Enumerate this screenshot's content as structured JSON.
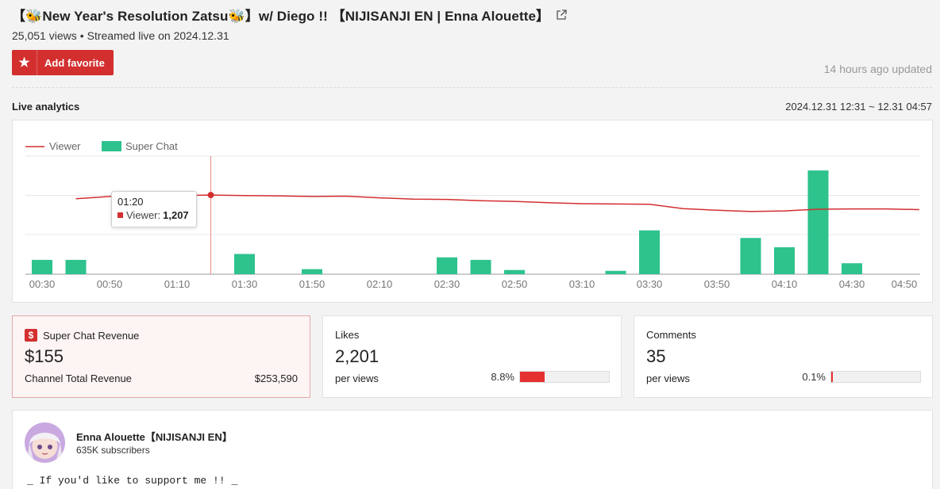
{
  "video": {
    "title": "【🐝New Year's Resolution Zatsu🐝】w/ Diego !! 【NIJISANJI EN | Enna Alouette】",
    "views": "25,051 views",
    "streamed": "Streamed live on 2024.12.31",
    "favorite_label": "Add favorite",
    "updated": "14 hours ago updated"
  },
  "analytics": {
    "section_title": "Live analytics",
    "range": "2024.12.31 12:31 ~ 12.31 04:57",
    "tooltip": {
      "time": "01:20",
      "label": "Viewer:",
      "value": "1,207"
    }
  },
  "chart_data": {
    "type": "line+bar",
    "legend": [
      "Viewer",
      "Super Chat"
    ],
    "legend_position": "top-left",
    "x_ticks": [
      "00:30",
      "00:50",
      "01:10",
      "01:30",
      "01:50",
      "02:10",
      "02:30",
      "02:50",
      "03:10",
      "03:30",
      "03:50",
      "04:10",
      "04:30",
      "04:50"
    ],
    "viewer": {
      "name": "Viewer",
      "color": "#d32f2f",
      "x_minutes": [
        40,
        50,
        60,
        70,
        80,
        90,
        100,
        110,
        120,
        130,
        140,
        150,
        160,
        170,
        180,
        190,
        200,
        210,
        220,
        230,
        240,
        250,
        260,
        270,
        280,
        290
      ],
      "values": [
        1150,
        1185,
        1200,
        1198,
        1207,
        1200,
        1195,
        1185,
        1190,
        1165,
        1145,
        1140,
        1120,
        1110,
        1090,
        1075,
        1070,
        1065,
        1000,
        975,
        955,
        965,
        990,
        995,
        995,
        985
      ],
      "hidden_range": [
        0,
        1800
      ]
    },
    "super_chat": {
      "name": "Super Chat",
      "color": "#2ec28d",
      "x_minutes": [
        30,
        40,
        90,
        110,
        150,
        160,
        170,
        200,
        210,
        240,
        250,
        260,
        270,
        280
      ],
      "values": [
        17,
        17,
        24,
        6,
        20,
        17,
        5,
        4,
        52,
        43,
        32,
        123,
        13,
        0
      ],
      "hidden_range": [
        0,
        140
      ]
    }
  },
  "cards": {
    "superchat": {
      "title": "Super Chat Revenue",
      "value": "$155",
      "sub_label": "Channel Total Revenue",
      "sub_value": "$253,590"
    },
    "likes": {
      "title": "Likes",
      "value": "2,201",
      "sub_label": "per views",
      "pct": "8.8%",
      "ratio": 0.088
    },
    "comments": {
      "title": "Comments",
      "value": "35",
      "sub_label": "per views",
      "pct": "0.1%",
      "ratio": 0.001
    }
  },
  "channel": {
    "name": "Enna Alouette【NIJISANJI EN】",
    "subscribers": "635K subscribers",
    "description": "_ If you'd like to support me !! _"
  },
  "colors": {
    "accent": "#d32f2f",
    "super_chat": "#2ec28d"
  }
}
